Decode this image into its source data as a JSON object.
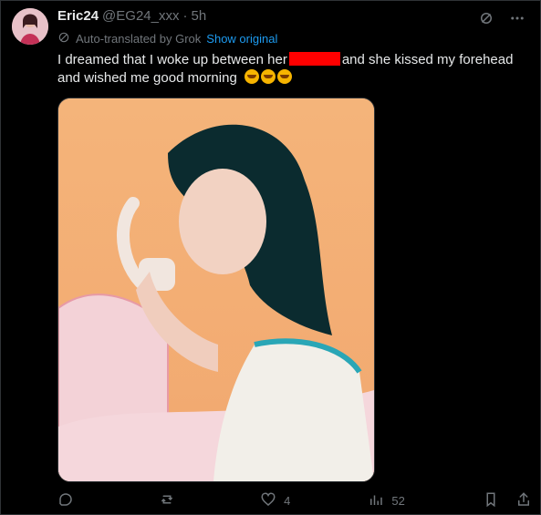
{
  "tweet": {
    "author_name": "Eric24",
    "author_handle": "@EG24_xxx",
    "separator": "·",
    "time_ago": "5h",
    "translation_note": "Auto-translated by Grok",
    "show_original_label": "Show original",
    "text_part1": "I dreamed that I woke up between her",
    "text_part2": "and she kissed my forehead and wished me good morning",
    "emoji": [
      "loudly-crying-face",
      "loudly-crying-face",
      "loudly-crying-face"
    ]
  },
  "icons": {
    "grok": "grok-icon",
    "more": "more-icon",
    "reply": "reply-icon",
    "retweet": "retweet-icon",
    "like": "heart-icon",
    "views": "views-icon",
    "bookmark": "bookmark-icon",
    "share": "share-icon"
  },
  "metrics": {
    "replies": "",
    "retweets": "",
    "likes": "4",
    "views": "52"
  },
  "colors": {
    "background": "#000000",
    "text": "#e7e9ea",
    "muted": "#71767b",
    "link": "#1d9bf0",
    "redaction": "#ff0000"
  }
}
